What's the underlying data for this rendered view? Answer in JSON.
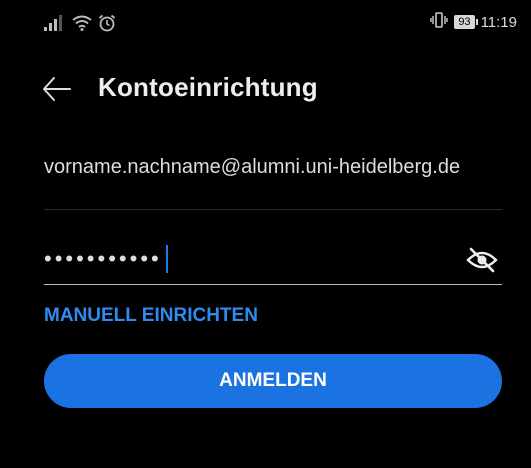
{
  "status_bar": {
    "time": "11:19",
    "battery": "93",
    "icons": [
      "signal-icon",
      "wifi-icon",
      "alarm-icon",
      "vibrate-icon",
      "battery-icon"
    ]
  },
  "app_bar": {
    "title": "Kontoeinrichtung",
    "back_icon": "arrow-left-icon"
  },
  "form": {
    "email_value": "vorname.nachname@alumni.uni-heidelberg.de",
    "password_masked": "•••••••••••",
    "password_visibility_icon": "eye-off-icon",
    "accent_color": "#1a73e0"
  },
  "actions": {
    "manual_setup_label": "MANUELL EINRICHTEN",
    "login_label": "ANMELDEN"
  }
}
